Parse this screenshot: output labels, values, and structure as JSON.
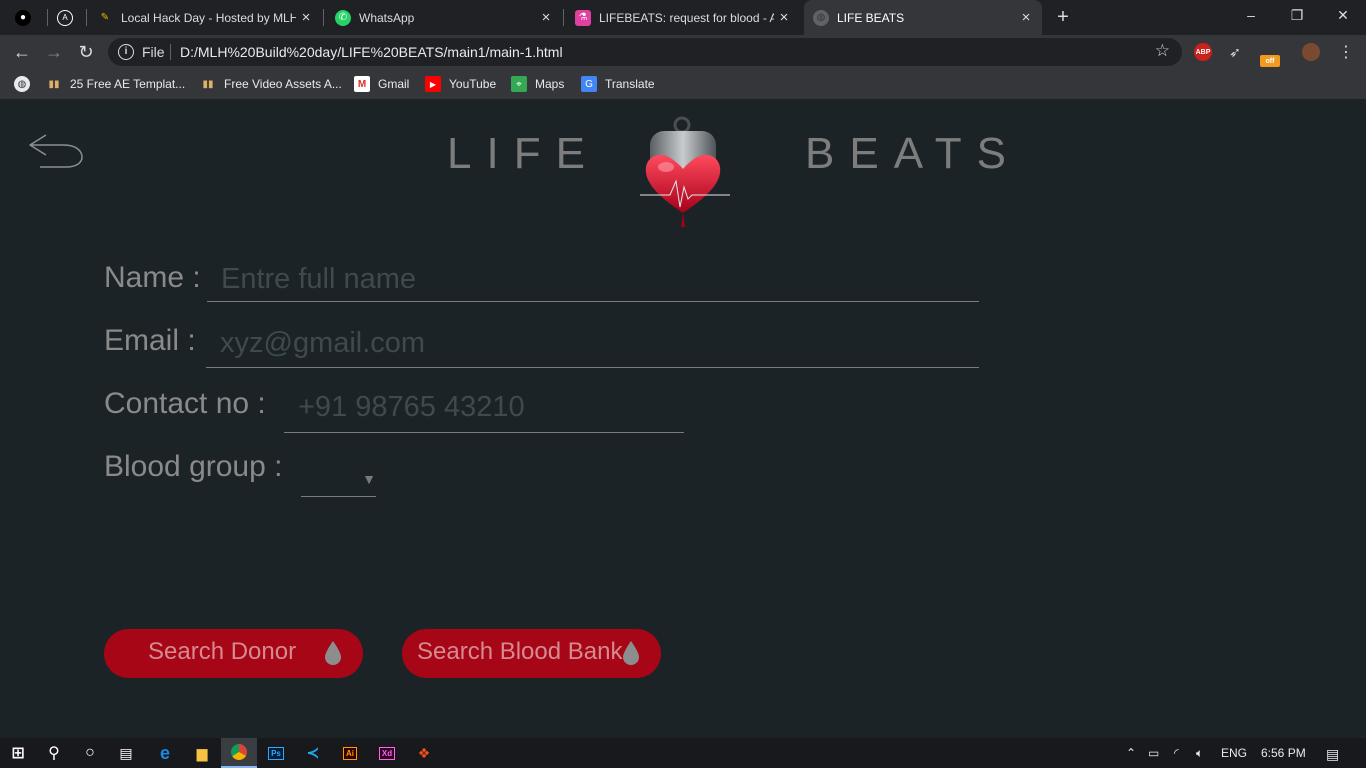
{
  "browser": {
    "tabs": [
      {
        "title": "",
        "favicon": "github-icon"
      },
      {
        "title": "",
        "favicon": "react-icon"
      },
      {
        "title": "Local Hack Day - Hosted by MLH",
        "favicon": "mlh-icon"
      },
      {
        "title": "WhatsApp",
        "favicon": "whatsapp-icon"
      },
      {
        "title": "LIFEBEATS: request for blood - Ar",
        "favicon": "flask-icon"
      },
      {
        "title": "LIFE BEATS",
        "favicon": "globe-icon",
        "active": true
      }
    ],
    "new_tab": "+",
    "window_controls": {
      "minimize": "–",
      "restore": "❐",
      "close": "✕"
    },
    "address": {
      "scheme": "File",
      "url": "D:/MLH%20Build%20day/LIFE%20BEATS/main1/main-1.html"
    },
    "extensions": {
      "abp": "ABP",
      "off": "off"
    },
    "bookmarks": [
      {
        "label": "25 Free AE Templat...",
        "icon": "bars-icon"
      },
      {
        "label": "Free Video Assets A...",
        "icon": "bars-icon"
      },
      {
        "label": "Gmail",
        "icon": "gmail-icon"
      },
      {
        "label": "YouTube",
        "icon": "youtube-icon"
      },
      {
        "label": "Maps",
        "icon": "maps-icon"
      },
      {
        "label": "Translate",
        "icon": "translate-icon"
      }
    ]
  },
  "page": {
    "brand_left": "LIFE",
    "brand_right": "BEATS",
    "form": {
      "name_label": "Name :",
      "name_placeholder": "Entre full name",
      "email_label": "Email :",
      "email_placeholder": "xyz@gmail.com",
      "contact_label": "Contact no :",
      "contact_placeholder": "+91 98765 43210",
      "blood_label": "Blood group :",
      "blood_value": ""
    },
    "buttons": {
      "search_donor": "Search Donor",
      "search_bank": "Search Blood  Bank"
    },
    "accent_color": "#a60615"
  },
  "taskbar": {
    "apps": [
      "start-icon",
      "search-icon",
      "cortana-icon",
      "task-view-icon",
      "edge-icon",
      "explorer-icon",
      "chrome-icon",
      "photoshop-icon",
      "vscode-icon",
      "illustrator-icon",
      "xd-icon",
      "figma-icon"
    ],
    "ps_label": "Ps",
    "ai_label": "Ai",
    "xd_label": "Xd",
    "language": "ENG",
    "time": "6:56 PM"
  }
}
